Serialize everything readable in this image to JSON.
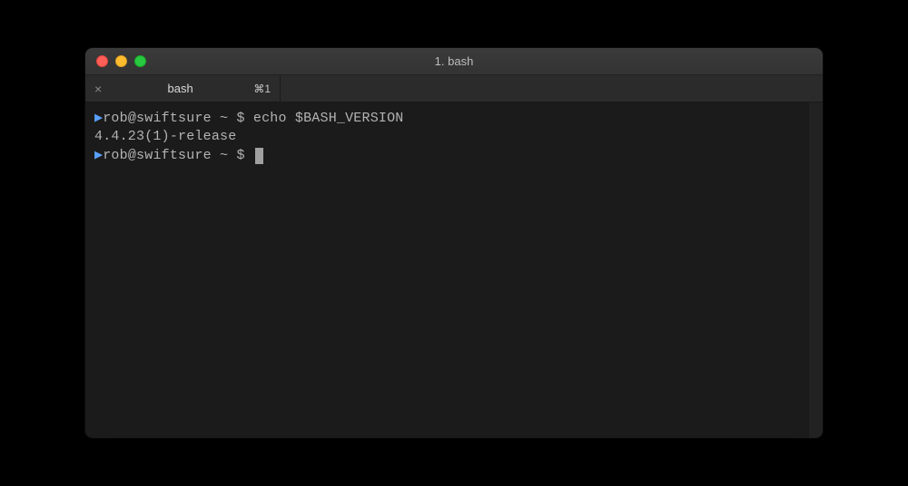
{
  "window": {
    "title": "1. bash"
  },
  "tab": {
    "label": "bash",
    "shortcut": "⌘1",
    "close_glyph": "×"
  },
  "terminal": {
    "lines": [
      {
        "marker": "▶",
        "prompt": "rob@swiftsure ~ $ ",
        "command": "echo $BASH_VERSION",
        "cursor": false
      },
      {
        "marker": "",
        "prompt": "",
        "command": "4.4.23(1)-release",
        "cursor": false
      },
      {
        "marker": "▶",
        "prompt": "rob@swiftsure ~ $ ",
        "command": "",
        "cursor": true
      }
    ]
  }
}
